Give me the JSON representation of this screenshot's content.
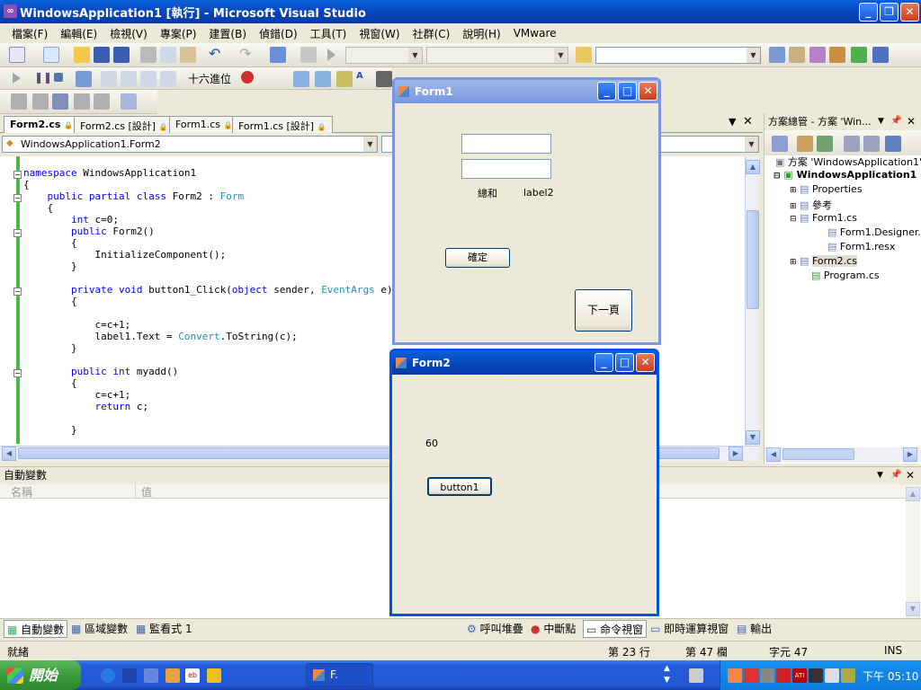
{
  "window": {
    "title": "WindowsApplication1 [執行] - Microsoft Visual Studio"
  },
  "menu": [
    "檔案(F)",
    "編輯(E)",
    "檢視(V)",
    "專案(P)",
    "建置(B)",
    "偵錯(D)",
    "工具(T)",
    "視窗(W)",
    "社群(C)",
    "說明(H)",
    "VMware"
  ],
  "toolbar": {
    "hex_label": "十六進位"
  },
  "tabs": [
    "Form2.cs",
    "Form2.cs [設計]",
    "Form1.cs",
    "Form1.cs [設計]"
  ],
  "nav": {
    "class_combo": "WindowsApplication1.Form2"
  },
  "code": [
    {
      "t": "namespace WindowsApplication1",
      "k": "namespace"
    },
    {
      "t": "{"
    },
    {
      "t": "    public partial class Form2 : Form"
    },
    {
      "t": "    {"
    },
    {
      "t": "        int c=0;"
    },
    {
      "t": "        public Form2()"
    },
    {
      "t": "        {"
    },
    {
      "t": "            InitializeComponent();"
    },
    {
      "t": "        }"
    },
    {
      "t": ""
    },
    {
      "t": "        private void button1_Click(object sender, EventArgs e)"
    },
    {
      "t": "        {"
    },
    {
      "t": ""
    },
    {
      "t": "            c=c+1;"
    },
    {
      "t": "            label1.Text = Convert.ToString(c);"
    },
    {
      "t": "        }"
    },
    {
      "t": ""
    },
    {
      "t": "        public int myadd()"
    },
    {
      "t": "        {"
    },
    {
      "t": "            c=c+1;"
    },
    {
      "t": "            return c;"
    },
    {
      "t": ""
    },
    {
      "t": "        }"
    }
  ],
  "solution_explorer": {
    "title": "方案總管 - 方案 'Win...",
    "items": [
      "方案 'WindowsApplication1' (",
      "WindowsApplication1",
      "Properties",
      "參考",
      "Form1.cs",
      "Form1.Designer.cs",
      "Form1.resx",
      "Form2.cs",
      "Program.cs"
    ]
  },
  "autos": {
    "title": "自動變數",
    "col_name": "名稱",
    "col_value": "值"
  },
  "bottom_tabs_left": [
    "自動變數",
    "區域變數",
    "監看式 1"
  ],
  "bottom_tabs_right": [
    "呼叫堆疊",
    "中斷點",
    "命令視窗",
    "即時運算視窗",
    "輸出"
  ],
  "form1": {
    "title": "Form1",
    "label_sum": "總和",
    "label2": "label2",
    "ok_button": "確定",
    "next_button": "下一頁"
  },
  "form2": {
    "title": "Form2",
    "label_value": "60",
    "button1": "button1"
  },
  "status": {
    "ready": "就緒",
    "line": "第 23 行",
    "col": "第 47 欄",
    "char": "字元 47",
    "ins": "INS"
  },
  "taskbar": {
    "start": "開始",
    "task": "F.",
    "clock": "下午 05:10"
  }
}
